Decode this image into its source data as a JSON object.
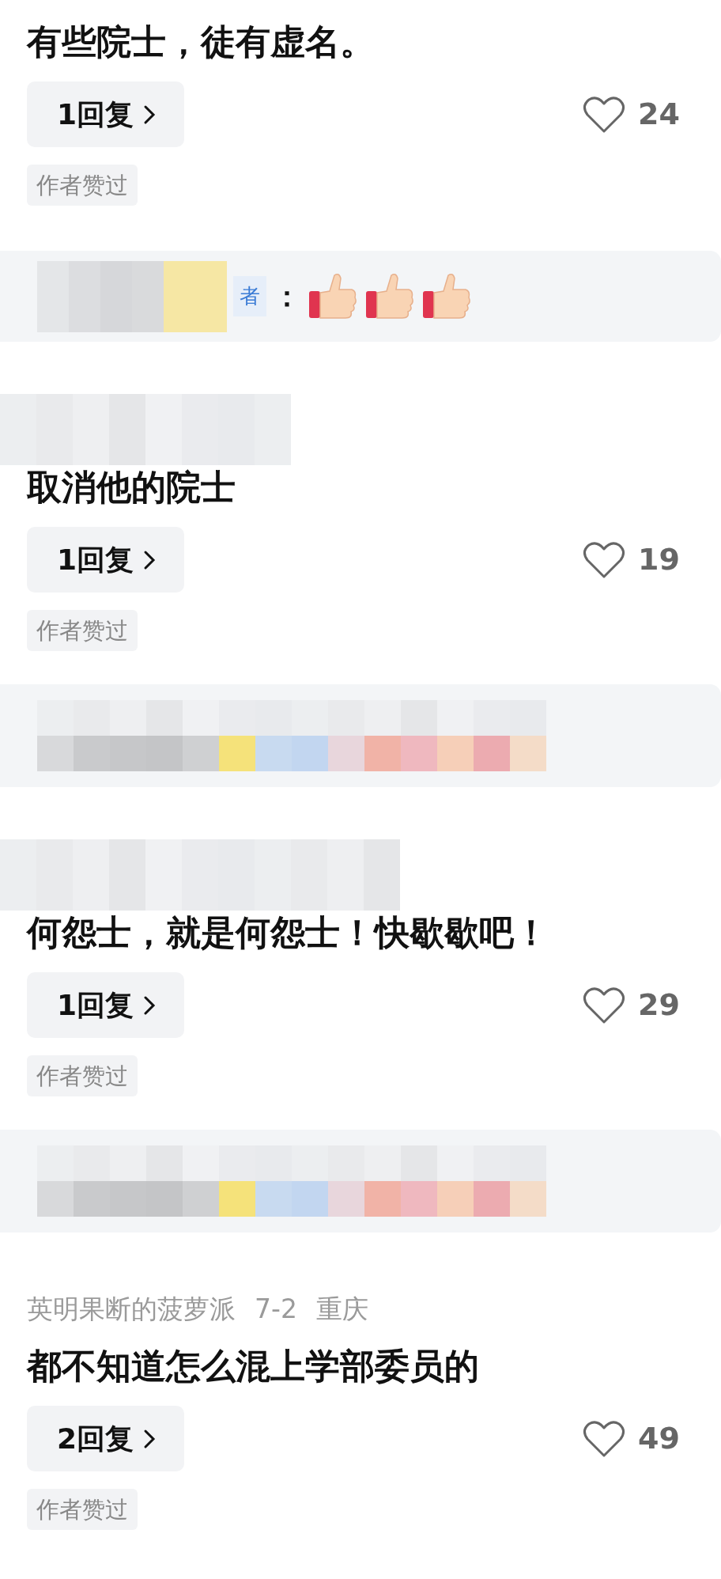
{
  "comments": [
    {
      "text": "有些院士，徒有虚名。",
      "replies": "1回复",
      "likes": "24",
      "liked": false,
      "badge": "作者赞过",
      "reply_preview": {
        "kind": "reaction",
        "name_tail": "者",
        "separator": "：",
        "reactions": [
          {
            "kind": "thumbs-up"
          },
          {
            "kind": "thumbs-up"
          },
          {
            "kind": "thumbs-up"
          }
        ]
      }
    },
    {
      "header": {
        "kind": "blurred"
      },
      "text": "取消他的院士",
      "replies": "1回复",
      "likes": "19",
      "liked": false,
      "badge": "作者赞过",
      "reply_preview": {
        "kind": "blurred"
      }
    },
    {
      "header": {
        "kind": "blurred"
      },
      "text": "何怨士，就是何怨士！快歇歇吧！",
      "replies": "1回复",
      "likes": "29",
      "liked": false,
      "badge": "作者赞过",
      "reply_preview": {
        "kind": "blurred"
      }
    },
    {
      "header": {
        "kind": "meta",
        "author": "英明果断的菠萝派",
        "date": "7-2",
        "location": "重庆"
      },
      "text": "都不知道怎么混上学部委员的",
      "replies": "2回复",
      "likes": "49",
      "liked": false,
      "badge": "作者赞过"
    }
  ]
}
